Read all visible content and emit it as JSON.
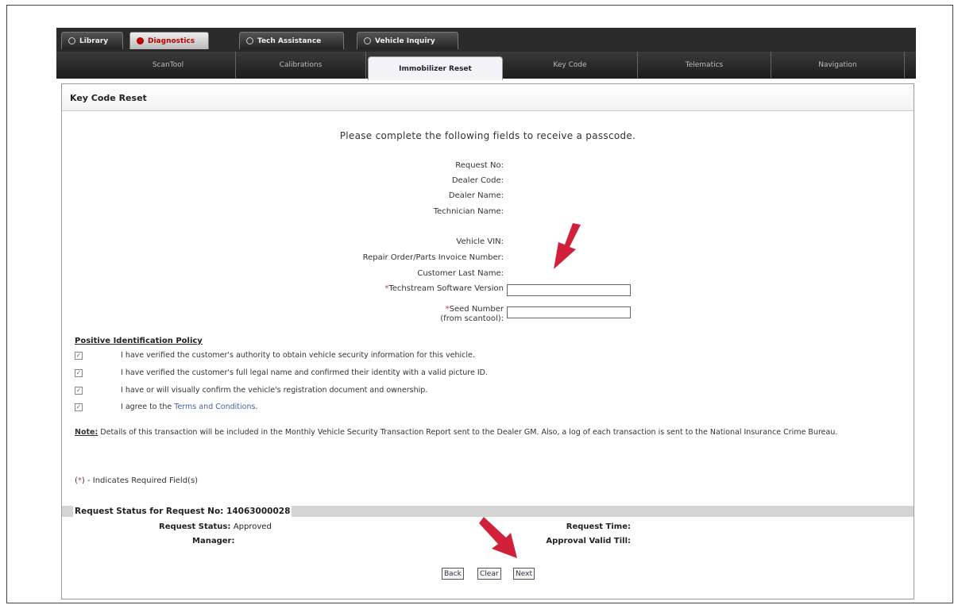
{
  "top_tabs": [
    {
      "label": "Library",
      "active": false
    },
    {
      "label": "Diagnostics",
      "active": true
    },
    {
      "label": "Tech Assistance",
      "active": false
    },
    {
      "label": "Vehicle Inquiry",
      "active": false
    }
  ],
  "sub_nav": [
    {
      "label": "ScanTool",
      "active": false
    },
    {
      "label": "Calibrations",
      "active": false
    },
    {
      "label": "Immobilizer Reset",
      "active": true
    },
    {
      "label": "Key Code",
      "active": false
    },
    {
      "label": "Telematics",
      "active": false
    },
    {
      "label": "Navigation",
      "active": false
    }
  ],
  "panel_title": "Key Code Reset",
  "instruction": "Please complete the following fields to receive a passcode.",
  "info_fields": [
    "Request No:",
    "Dealer Code:",
    "Dealer Name:",
    "Technician Name:",
    "Vehicle VIN:",
    "Repair Order/Parts Invoice Number:",
    "Customer Last Name:"
  ],
  "inputs": {
    "techstream_label": "Techstream Software Version",
    "techstream_value": "",
    "seed_label": "Seed Number",
    "seed_sublabel": "(from scantool):",
    "seed_value": "",
    "required_mark": "*"
  },
  "policy": {
    "title": "Positive Identification Policy",
    "items": [
      "I have verified the customer's authority to obtain vehicle security information for this vehicle.",
      "I have verified the customer's full legal name and confirmed their identity with a valid picture ID.",
      "I have or will visually confirm the vehicle's registration document and ownership."
    ],
    "terms_prefix": "I agree to the ",
    "terms_link": "Terms and Conditions",
    "terms_suffix": "."
  },
  "note": {
    "label": "Note:",
    "text": " Details of this transaction will be included in the Monthly Vehicle Security Transaction Report sent to the Dealer GM. Also, a log of each transaction is sent to the National Insurance Crime Bureau."
  },
  "required_note": {
    "open": "(",
    "mark": "*",
    "close": ") - Indicates Required Field(s)"
  },
  "request_status": {
    "header": "Request Status for Request No: 14063000028",
    "status_label": "Request Status:",
    "status_value": "Approved",
    "manager_label": "Manager:",
    "time_label": "Request Time:",
    "valid_label": "Approval Valid Till:"
  },
  "buttons": {
    "back": "Back",
    "clear": "Clear",
    "next": "Next"
  },
  "colors": {
    "arrow": "#d0203a",
    "required": "#d03040",
    "link": "#4a5fa8"
  }
}
